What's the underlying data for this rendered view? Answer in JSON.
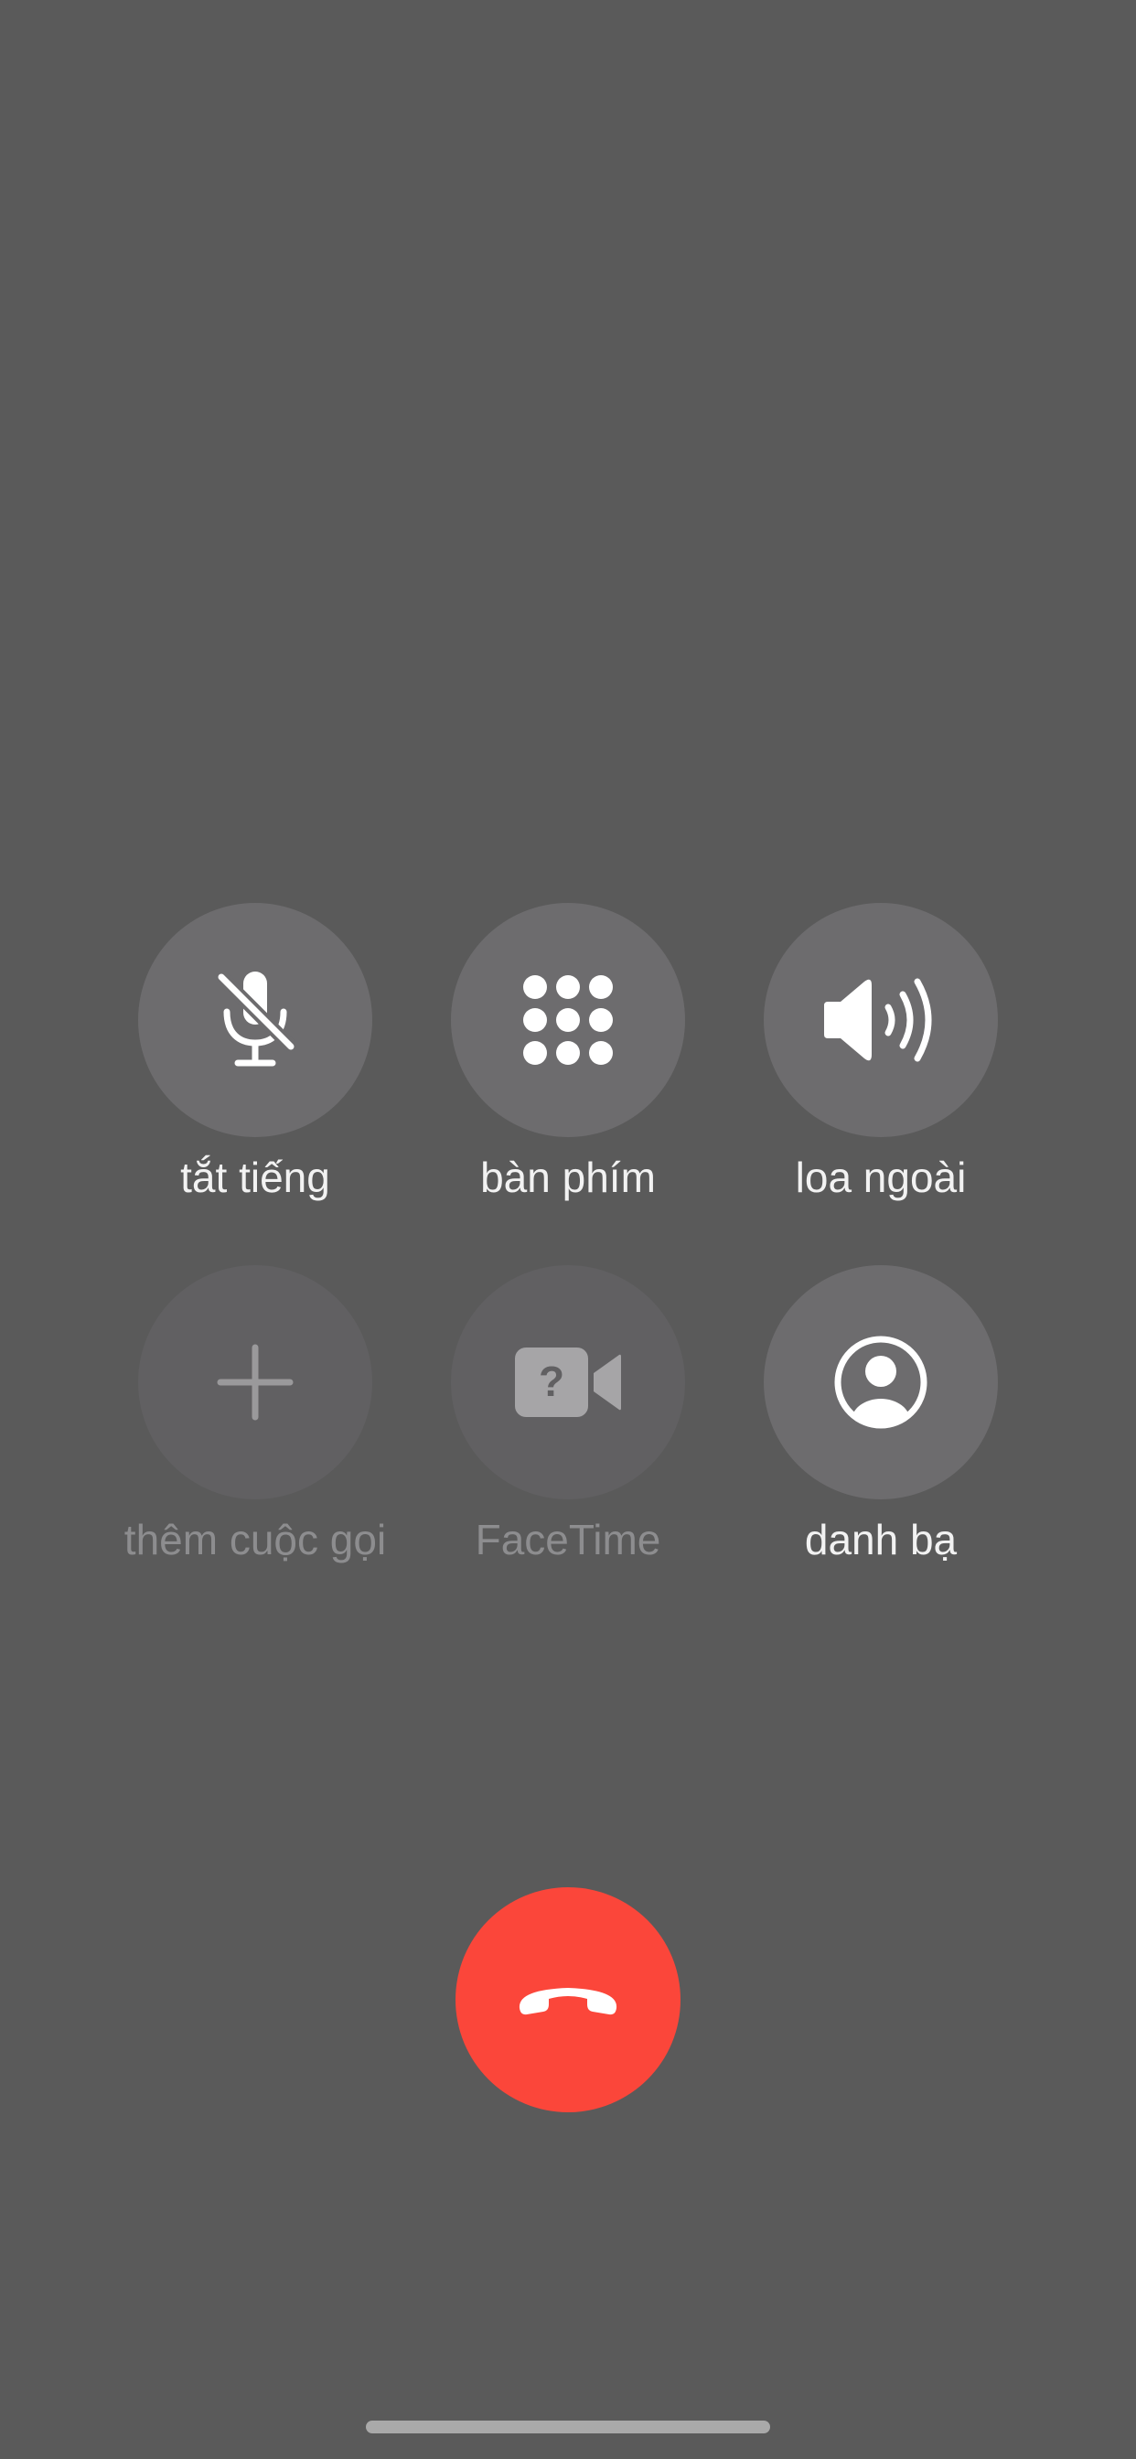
{
  "controls": {
    "mute": {
      "label": "tắt tiếng",
      "icon": "mic-slash-icon",
      "enabled": true
    },
    "keypad": {
      "label": "bàn phím",
      "icon": "keypad-icon",
      "enabled": true
    },
    "speaker": {
      "label": "loa ngoài",
      "icon": "speaker-wave-icon",
      "enabled": true
    },
    "add_call": {
      "label": "thêm cuộc gọi",
      "icon": "plus-icon",
      "enabled": false
    },
    "facetime": {
      "label": "FaceTime",
      "icon": "video-question-icon",
      "enabled": false
    },
    "contacts": {
      "label": "danh bạ",
      "icon": "person-circle-icon",
      "enabled": true
    }
  },
  "end_call": {
    "icon": "phone-hangup-icon"
  },
  "colors": {
    "background": "#5a5a5a",
    "button": "#6d6c6e",
    "button_disabled": "#616062",
    "end_call": "#fb463a",
    "label": "#f2f2f2",
    "label_disabled": "#8d8d8f"
  }
}
